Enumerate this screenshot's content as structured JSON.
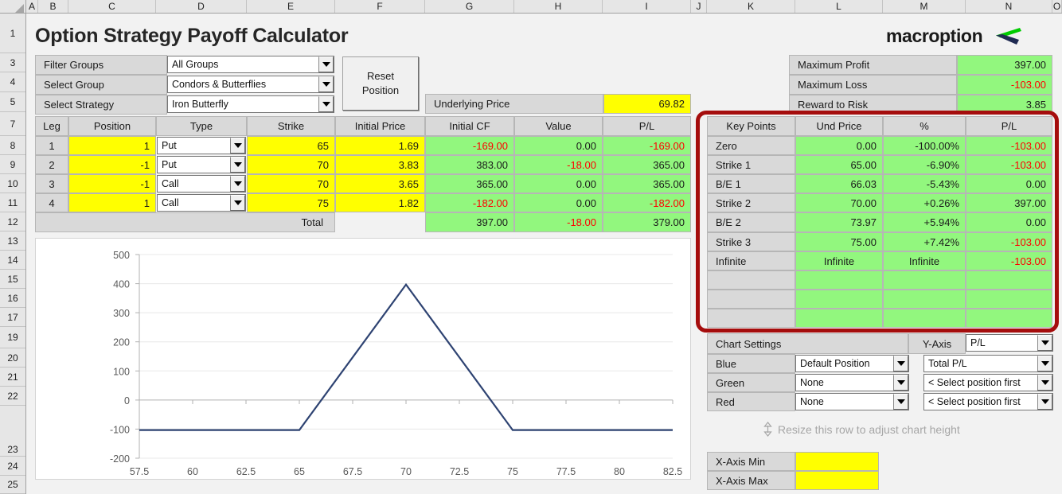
{
  "header": {
    "title": "Option Strategy Payoff Calculator",
    "logo_text": "macroption",
    "logo_icon": "macroption-chevron-logo",
    "logo_colors": {
      "green": "#00cc00",
      "navy": "#1f2a52"
    }
  },
  "columns": [
    "A",
    "B",
    "C",
    "D",
    "E",
    "F",
    "G",
    "H",
    "I",
    "J",
    "K",
    "L",
    "M",
    "N",
    "O"
  ],
  "rows": [
    "1",
    "3",
    "4",
    "5",
    "7",
    "8",
    "9",
    "10",
    "11",
    "12",
    "13",
    "14",
    "15",
    "16",
    "17",
    "19",
    "20",
    "21",
    "22",
    "23",
    "24",
    "25"
  ],
  "selectors": {
    "filter_groups_label": "Filter Groups",
    "filter_groups_value": "All Groups",
    "select_group_label": "Select Group",
    "select_group_value": "Condors & Butterflies",
    "select_strategy_label": "Select Strategy",
    "select_strategy_value": "Iron Butterfly",
    "reset_button_line1": "Reset",
    "reset_button_line2": "Position"
  },
  "underlying": {
    "label": "Underlying Price",
    "value": "69.82"
  },
  "summary": [
    {
      "label": "Maximum Profit",
      "value": "397.00",
      "negative": false
    },
    {
      "label": "Maximum Loss",
      "value": "-103.00",
      "negative": true
    },
    {
      "label": "Reward to Risk",
      "value": "3.85",
      "negative": false
    }
  ],
  "legs_table": {
    "headers": [
      "Leg",
      "Position",
      "Type",
      "Strike",
      "Initial Price",
      "Initial CF",
      "Value",
      "P/L"
    ],
    "rows": [
      {
        "leg": "1",
        "position": "1",
        "type": "Put",
        "strike": "65",
        "initial_price": "1.69",
        "initial_cf": "-169.00",
        "value": "0.00",
        "pl": "-169.00"
      },
      {
        "leg": "2",
        "position": "-1",
        "type": "Put",
        "strike": "70",
        "initial_price": "3.83",
        "initial_cf": "383.00",
        "value": "-18.00",
        "pl": "365.00"
      },
      {
        "leg": "3",
        "position": "-1",
        "type": "Call",
        "strike": "70",
        "initial_price": "3.65",
        "initial_cf": "365.00",
        "value": "0.00",
        "pl": "365.00"
      },
      {
        "leg": "4",
        "position": "1",
        "type": "Call",
        "strike": "75",
        "initial_price": "1.82",
        "initial_cf": "-182.00",
        "value": "0.00",
        "pl": "-182.00"
      }
    ],
    "total_label": "Total",
    "total": {
      "initial_cf": "397.00",
      "value": "-18.00",
      "pl": "379.00"
    }
  },
  "key_points": {
    "headers": [
      "Key Points",
      "Und Price",
      "%",
      "P/L"
    ],
    "rows": [
      {
        "name": "Zero",
        "und_price": "0.00",
        "pct": "-100.00%",
        "pl": "-103.00"
      },
      {
        "name": "Strike 1",
        "und_price": "65.00",
        "pct": "-6.90%",
        "pl": "-103.00"
      },
      {
        "name": "B/E 1",
        "und_price": "66.03",
        "pct": "-5.43%",
        "pl": "0.00"
      },
      {
        "name": "Strike 2",
        "und_price": "70.00",
        "pct": "+0.26%",
        "pl": "397.00"
      },
      {
        "name": "B/E 2",
        "und_price": "73.97",
        "pct": "+5.94%",
        "pl": "0.00"
      },
      {
        "name": "Strike 3",
        "und_price": "75.00",
        "pct": "+7.42%",
        "pl": "-103.00"
      },
      {
        "name": "Infinite",
        "und_price": "Infinite",
        "pct": "Infinite",
        "pl": "-103.00"
      },
      {
        "name": "",
        "und_price": "",
        "pct": "",
        "pl": ""
      },
      {
        "name": "",
        "und_price": "",
        "pct": "",
        "pl": ""
      },
      {
        "name": "",
        "und_price": "",
        "pct": "",
        "pl": ""
      }
    ],
    "highlight_color": "#a50d0d"
  },
  "chart_settings": {
    "title": "Chart Settings",
    "y_axis_label": "Y-Axis",
    "y_axis_value": "P/L",
    "rows": [
      {
        "color_label": "Blue",
        "position_value": "Default Position",
        "series_value": "Total P/L"
      },
      {
        "color_label": "Green",
        "position_value": "None",
        "series_value": "< Select position first"
      },
      {
        "color_label": "Red",
        "position_value": "None",
        "series_value": "< Select position first"
      }
    ],
    "resize_hint": "Resize this row to adjust chart height",
    "resize_icon": "resize-vertical-icon",
    "x_axis_min_label": "X-Axis Min",
    "x_axis_min_value": "",
    "x_axis_max_label": "X-Axis Max",
    "x_axis_max_value": ""
  },
  "chart_data": {
    "type": "line",
    "title": "",
    "xlabel": "",
    "ylabel": "",
    "series": [
      {
        "name": "Total P/L",
        "color": "#2e4372",
        "x": [
          57.5,
          65,
          70,
          75,
          82.5
        ],
        "y": [
          -103,
          -103,
          397,
          -103,
          -103
        ]
      }
    ],
    "xlim": [
      57.5,
      82.5
    ],
    "ylim": [
      -200,
      500
    ],
    "xticks": [
      "57.5",
      "60",
      "62.5",
      "65",
      "67.5",
      "70",
      "72.5",
      "75",
      "77.5",
      "80",
      "82.5"
    ],
    "yticks": [
      "-200",
      "-100",
      "0",
      "100",
      "200",
      "300",
      "400",
      "500"
    ],
    "grid": true,
    "legend": "none"
  }
}
